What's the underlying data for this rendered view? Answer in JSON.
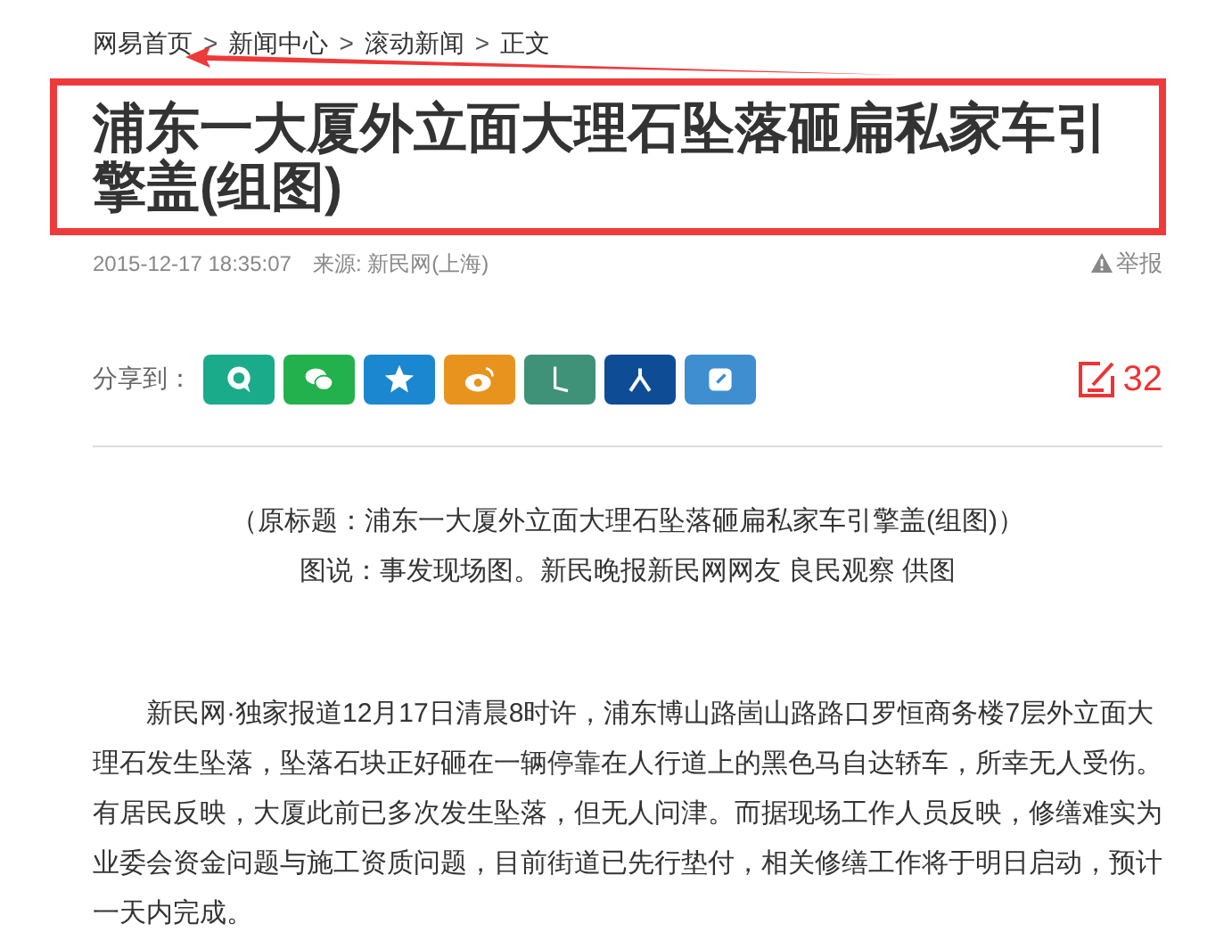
{
  "breadcrumb": [
    "网易首页",
    "新闻中心",
    "滚动新闻",
    "正文"
  ],
  "breadcrumb_separator": ">",
  "title": "浦东一大厦外立面大理石坠落砸扁私家车引擎盖(组图)",
  "meta": {
    "time": "2015-12-17 18:35:07",
    "source": "来源: 新民网(上海)",
    "report": "举报"
  },
  "share": {
    "label": "分享到：",
    "buttons": [
      {
        "kind": "bubble",
        "color": "#1aab8a"
      },
      {
        "kind": "chat",
        "color": "#22b14c"
      },
      {
        "kind": "star",
        "color": "#1a87d0"
      },
      {
        "kind": "eye",
        "color": "#e8931e"
      },
      {
        "kind": "hook",
        "color": "#3f9178"
      },
      {
        "kind": "person",
        "color": "#0f4c96"
      },
      {
        "kind": "note",
        "color": "#3e8ed0"
      }
    ]
  },
  "comments": {
    "count": "32"
  },
  "captions": [
    "（原标题：浦东一大厦外立面大理石坠落砸扁私家车引擎盖(组图)）",
    "图说：事发现场图。新民晚报新民网网友 良民观察 供图"
  ],
  "body": "新民网·独家报道12月17日清晨8时许，浦东博山路崮山路路口罗恒商务楼7层外立面大理石发生坠落，坠落石块正好砸在一辆停靠在人行道上的黑色马自达轿车，所幸无人受伤。有居民反映，大厦此前已多次发生坠落，但无人问津。而据现场工作人员反映，修缮难实为业委会资金问题与施工资质问题，目前街道已先行垫付，相关修缮工作将于明日启动，预计一天内完成。"
}
